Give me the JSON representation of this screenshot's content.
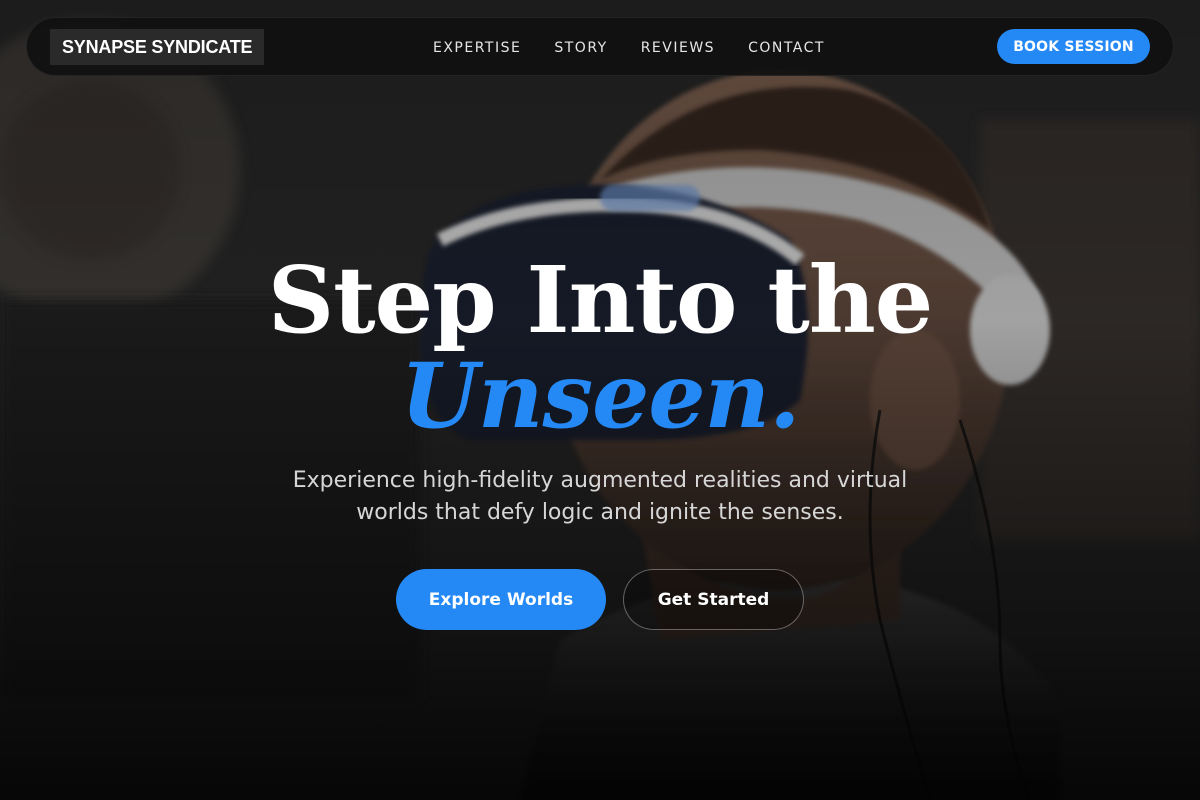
{
  "nav": {
    "brand": "SYNAPSE SYNDICATE",
    "links": [
      "EXPERTISE",
      "STORY",
      "REVIEWS",
      "CONTACT"
    ],
    "cta": "BOOK SESSION"
  },
  "hero": {
    "headline_line1": "Step Into the",
    "headline_line2": "Unseen.",
    "subtitle": "Experience high-fidelity augmented realities and virtual worlds that defy logic and ignite the senses.",
    "primary_button": "Explore Worlds",
    "secondary_button": "Get Started"
  },
  "colors": {
    "accent": "#2489f5",
    "nav_background": "#101010",
    "brand_background": "#2a2a2a",
    "text_primary": "#ffffff",
    "text_secondary": "#d6d6d6"
  }
}
